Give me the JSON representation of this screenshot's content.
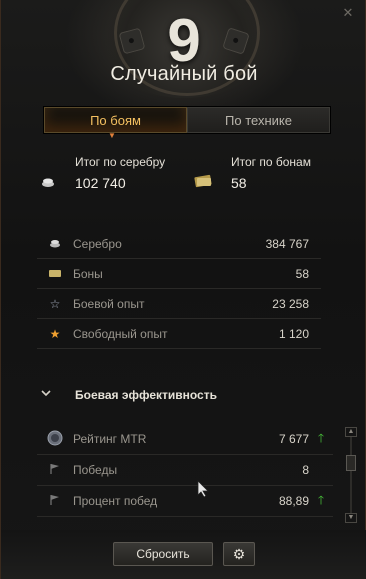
{
  "window": {
    "level": "9",
    "title": "Случайный бой",
    "close_icon": "close-icon"
  },
  "tabs": [
    {
      "label": "По боям",
      "active": true
    },
    {
      "label": "По технике",
      "active": false
    }
  ],
  "totals": {
    "silver": {
      "label": "Итог по серебру",
      "value": "102 740",
      "icon": "silver-icon"
    },
    "bonds": {
      "label": "Итог по бонам",
      "value": "58",
      "icon": "bonds-icon"
    }
  },
  "stats": [
    {
      "label": "Серебро",
      "value": "384 767",
      "icon": "silver-icon"
    },
    {
      "label": "Боны",
      "value": "58",
      "icon": "bonds-icon"
    },
    {
      "label": "Боевой опыт",
      "value": "23 258",
      "icon": "star-outline-icon"
    },
    {
      "label": "Свободный опыт",
      "value": "1 120",
      "icon": "star-gold-icon"
    }
  ],
  "efficiency": {
    "title": "Боевая эффективность",
    "rows": [
      {
        "label": "Рейтинг MTR",
        "value": "7 677",
        "trend": "up",
        "icon": "rating-badge-icon"
      },
      {
        "label": "Победы",
        "value": "8",
        "trend": "",
        "icon": "flag-icon"
      },
      {
        "label": "Процент побед",
        "value": "88,89",
        "trend": "up",
        "icon": "flag-icon"
      }
    ]
  },
  "footer": {
    "reset_label": "Сбросить",
    "settings_icon": "gear-icon"
  },
  "colors": {
    "accent_orange": "#f4c060",
    "trend_up": "#49c23a"
  }
}
